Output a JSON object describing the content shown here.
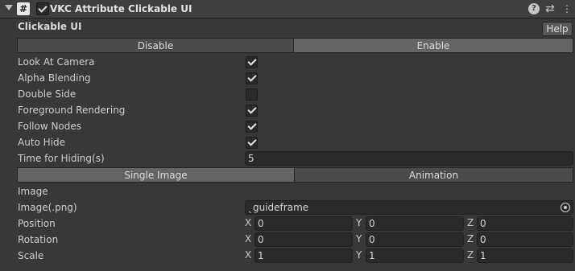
{
  "header": {
    "title": "VKC Attribute Clickable UI",
    "icon_glyph": "#",
    "enabled": true,
    "icons": [
      "help-icon",
      "preset-icon",
      "more-options-icon"
    ]
  },
  "section": {
    "title": "Clickable UI",
    "help_label": "Help"
  },
  "mode_toggle": {
    "disable_label": "Disable",
    "enable_label": "Enable",
    "selected": "Enable"
  },
  "options": [
    {
      "label": "Look At Camera",
      "checked": true
    },
    {
      "label": "Alpha Blending",
      "checked": true
    },
    {
      "label": "Double Side",
      "checked": false
    },
    {
      "label": "Foreground Rendering",
      "checked": true
    },
    {
      "label": "Follow Nodes",
      "checked": true
    },
    {
      "label": "Auto Hide",
      "checked": true
    }
  ],
  "time_hiding": {
    "label": "Time for Hiding(s)",
    "value": "5"
  },
  "image_toggle": {
    "single_label": "Single Image",
    "animation_label": "Animation",
    "selected": "Single Image"
  },
  "image_section_label": "Image",
  "image_png": {
    "label": "Image(.png)",
    "value": "guideframe",
    "prefix_glyph": "ˎ"
  },
  "transforms": [
    {
      "label": "Position",
      "x": "0",
      "y": "0",
      "z": "0"
    },
    {
      "label": "Rotation",
      "x": "0",
      "y": "0",
      "z": "0"
    },
    {
      "label": "Scale",
      "x": "1",
      "y": "1",
      "z": "1"
    }
  ],
  "axis_labels": {
    "x": "X",
    "y": "Y",
    "z": "Z"
  },
  "colors": {
    "background": "#383838",
    "toggle_selected": "#646464",
    "toggle_unselected": "#4b4b4b",
    "field": "#2a2a2a"
  }
}
